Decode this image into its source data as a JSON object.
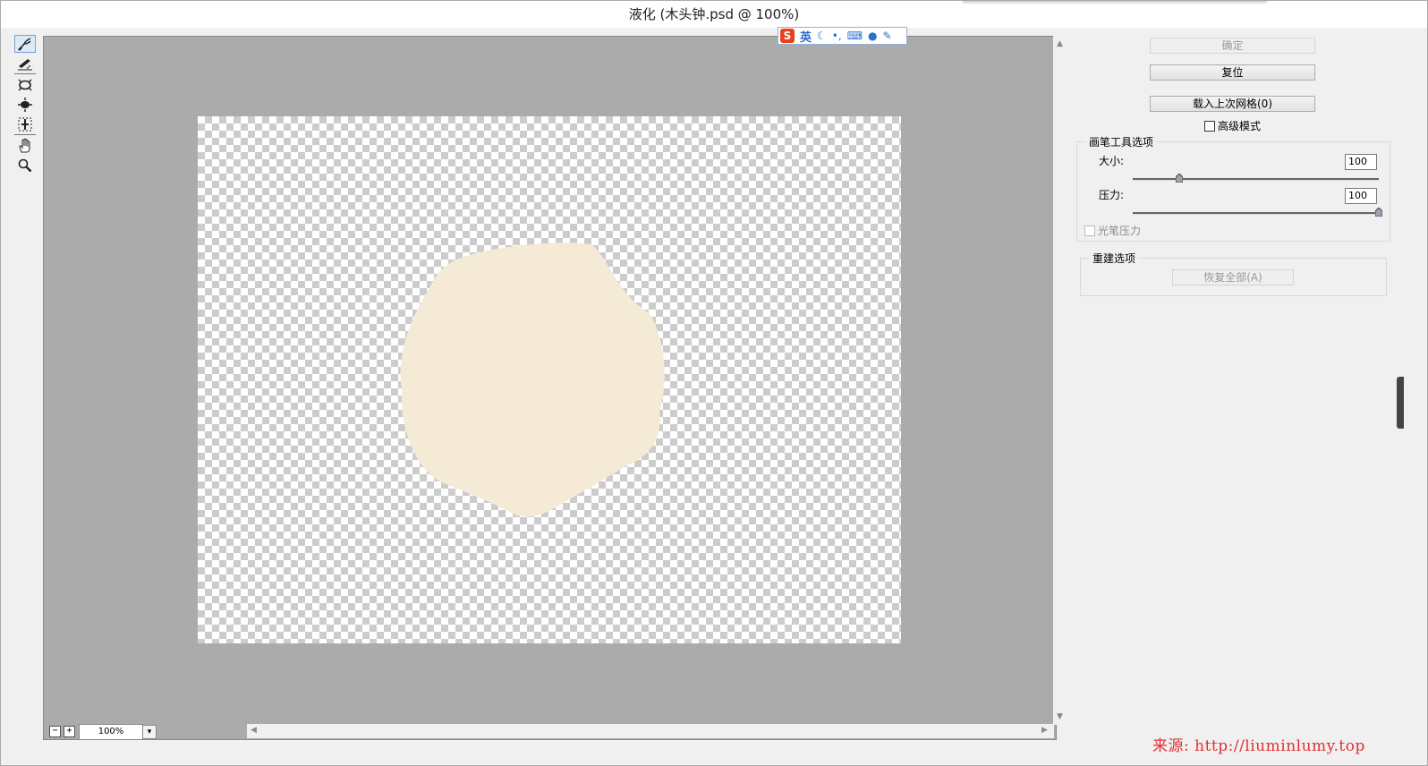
{
  "window": {
    "title": "液化 (木头钟.psd @ 100%)"
  },
  "toolbar": {
    "tools": [
      {
        "name": "forward-warp-icon",
        "active": true
      },
      {
        "name": "reconstruct-icon",
        "active": false
      },
      {
        "name": "bloat-icon",
        "active": false
      },
      {
        "name": "pucker-icon",
        "active": false
      },
      {
        "name": "push-left-icon",
        "active": false
      },
      {
        "name": "hand-icon",
        "active": false
      },
      {
        "name": "zoom-icon",
        "active": false
      }
    ]
  },
  "ime": {
    "logo": "S",
    "mode": "英",
    "icons": [
      "moon-icon",
      "punctuation-icon",
      "keyboard-icon",
      "user-icon",
      "wrench-icon"
    ]
  },
  "status": {
    "zoom_out": "−",
    "zoom_in": "+",
    "zoom": "100%",
    "dropdown": "▾"
  },
  "panel": {
    "ok_label": "确定",
    "reset_label": "复位",
    "load_mesh_label": "载入上次网格(0)",
    "advanced_label": "高级模式",
    "brush_group_title": "画笔工具选项",
    "size_label": "大小:",
    "size_value": "100",
    "pressure_label": "压力:",
    "pressure_value": "100",
    "stylus_label": "光笔压力",
    "rebuild_group_title": "重建选项",
    "restore_all_label": "恢复全部(A)"
  },
  "sliders": {
    "size_fraction": 0.19,
    "pressure_fraction": 1.0
  },
  "shape_color": "#f5ead5",
  "watermark": "来源: http://liuminlumy.top"
}
